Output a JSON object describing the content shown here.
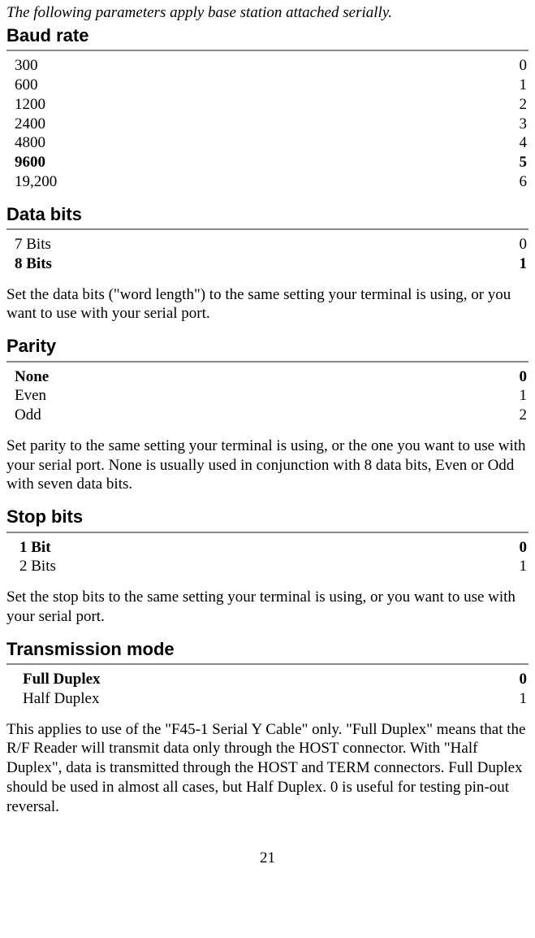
{
  "intro": "The following parameters apply base station attached serially.",
  "sections": {
    "baud": {
      "title": "Baud rate",
      "rows": [
        {
          "label": "300",
          "val": "0",
          "bold": false
        },
        {
          "label": "600",
          "val": "1",
          "bold": false
        },
        {
          "label": "1200",
          "val": "2",
          "bold": false
        },
        {
          "label": "2400",
          "val": "3",
          "bold": false
        },
        {
          "label": "4800",
          "val": "4",
          "bold": false
        },
        {
          "label": "9600",
          "val": "5",
          "bold": true
        },
        {
          "label": "19,200",
          "val": "6",
          "bold": false
        }
      ]
    },
    "databits": {
      "title": "Data bits",
      "rows": [
        {
          "label": "7 Bits",
          "val": "0",
          "bold": false
        },
        {
          "label": "8 Bits",
          "val": "1",
          "bold": true
        }
      ],
      "desc": "Set the data bits (\"word length\") to the same setting your terminal is using, or you want to use with your serial port."
    },
    "parity": {
      "title": "Parity",
      "rows": [
        {
          "label": "None",
          "val": "0",
          "bold": true
        },
        {
          "label": "Even",
          "val": "1",
          "bold": false
        },
        {
          "label": "Odd",
          "val": "2",
          "bold": false
        }
      ],
      "desc": "Set parity to the same setting your terminal is using, or the one you want to use with your serial port.  None is usually used in conjunction with 8 data bits, Even or Odd with seven data bits."
    },
    "stopbits": {
      "title": "Stop bits",
      "rows": [
        {
          "label": "1 Bit",
          "val": "0",
          "bold": true
        },
        {
          "label": "2 Bits",
          "val": "1",
          "bold": false
        }
      ],
      "desc": "Set the stop bits to the same setting your terminal is using, or you want to use with your serial port."
    },
    "transmission": {
      "title": "Transmission mode",
      "rows": [
        {
          "label": "Full Duplex",
          "val": "0",
          "bold": true
        },
        {
          "label": "Half Duplex",
          "val": "1",
          "bold": false
        }
      ],
      "desc": "This applies to use of the \"F45-1 Serial Y Cable\" only.  \"Full Duplex\" means that the R/F Reader will transmit data only through the HOST connector. With \"Half Duplex\", data is transmitted through the HOST and TERM connectors.  Full Duplex should be used in almost all cases, but Half Duplex. 0 is useful for testing pin-out reversal."
    }
  },
  "page_number": "21"
}
